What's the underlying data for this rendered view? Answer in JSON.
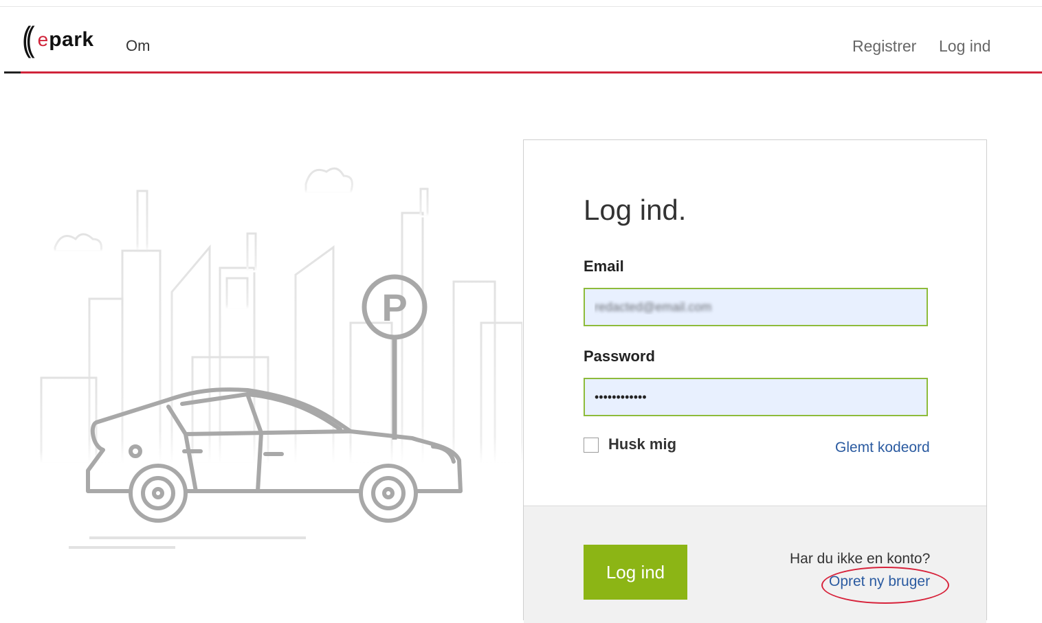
{
  "brand": {
    "logo_parens": "((",
    "logo_e": "e",
    "logo_park": "park",
    "accent": "#d0243a"
  },
  "nav": {
    "om": "Om",
    "register": "Registrer",
    "login": "Log ind"
  },
  "illustration": {
    "sign_letter": "P"
  },
  "form": {
    "title": "Log ind.",
    "email_label": "Email",
    "email_value": "redacted@email.com",
    "password_label": "Password",
    "password_value": "••••••••••••",
    "remember_label": "Husk mig",
    "forgot_link": "Glemt kodeord",
    "submit_label": "Log ind",
    "no_account_text": "Har du ikke en konto?",
    "create_user_link": "Opret ny bruger",
    "button_color": "#8cb515",
    "input_border_color": "#8dbb3a",
    "link_color": "#2a5aa0"
  }
}
